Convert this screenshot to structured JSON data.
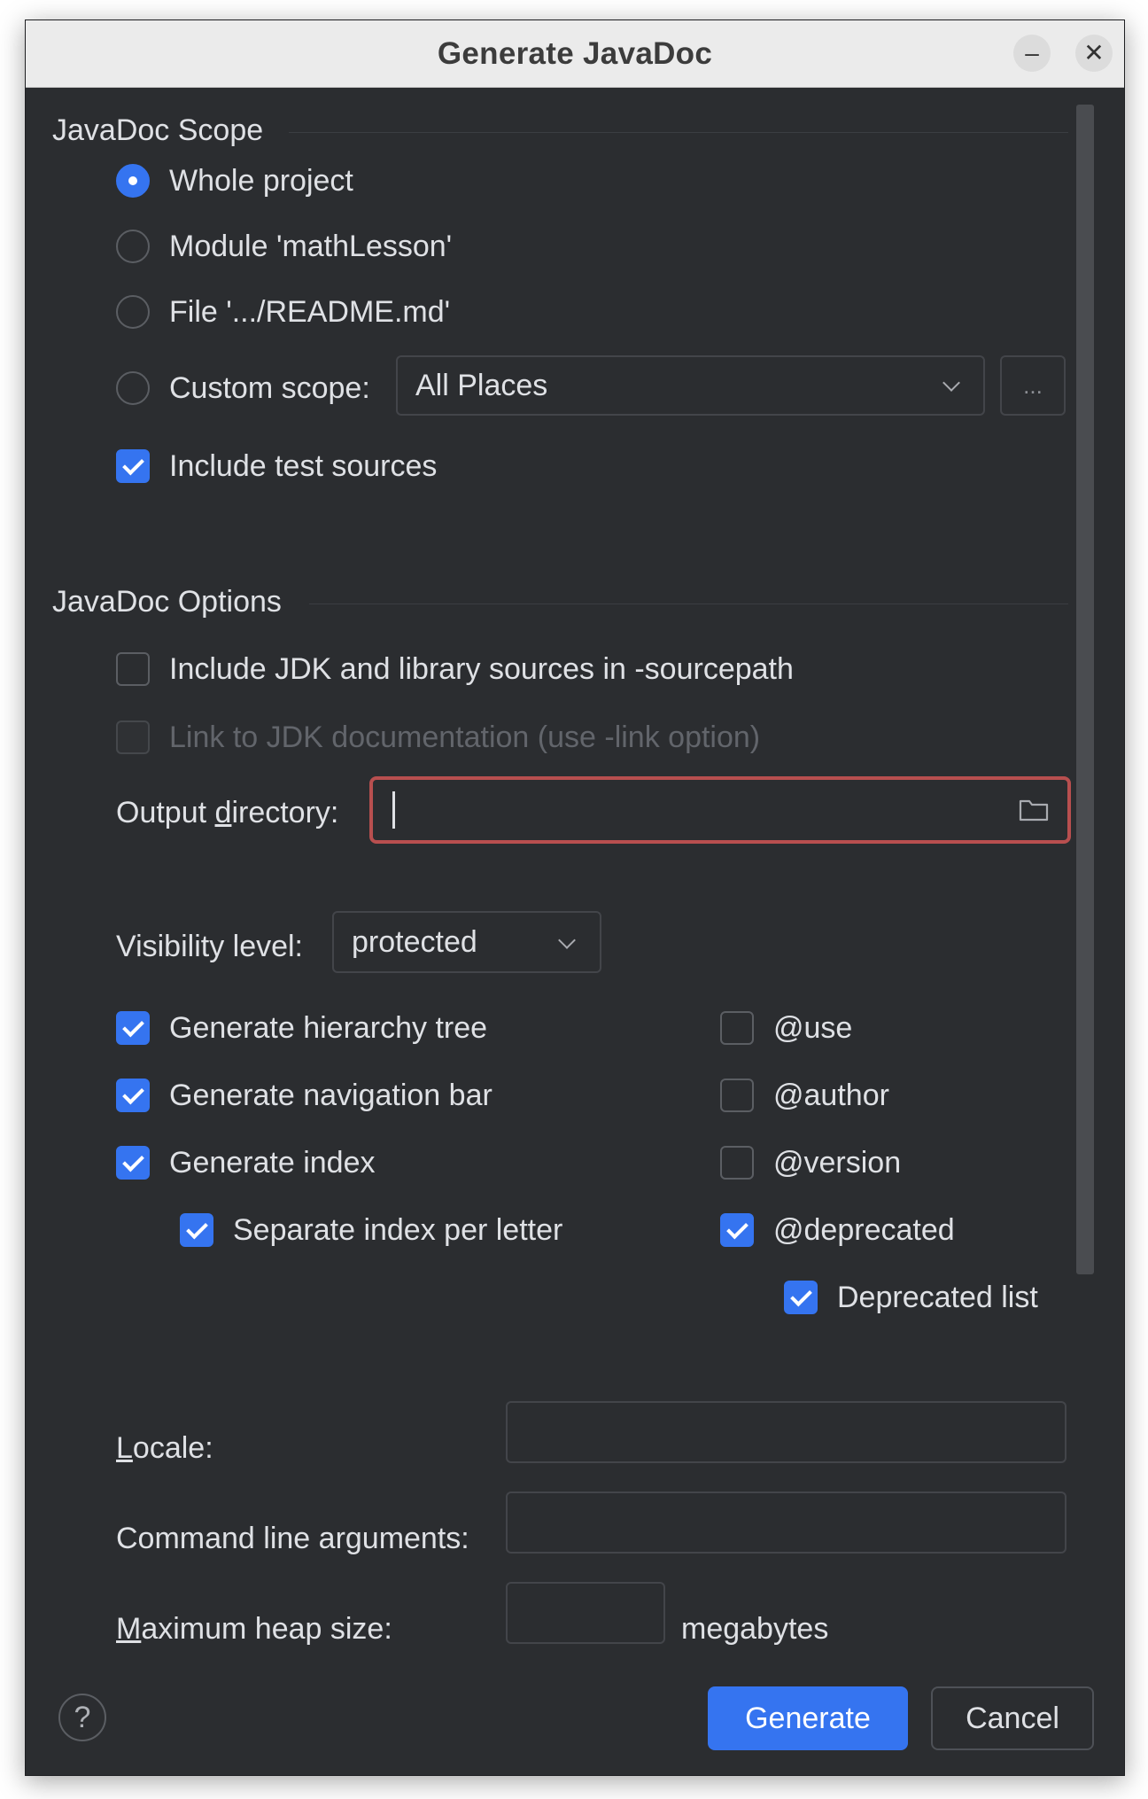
{
  "window": {
    "title": "Generate JavaDoc",
    "minimize_glyph": "–",
    "close_glyph": "✕"
  },
  "scope": {
    "section_title": "JavaDoc Scope",
    "options": [
      {
        "label": "Whole project",
        "selected": true
      },
      {
        "label": "Module 'mathLesson'",
        "selected": false
      },
      {
        "label": "File '.../README.md'",
        "selected": false
      },
      {
        "label": "Custom scope:",
        "selected": false
      }
    ],
    "custom_scope_value": "All Places",
    "browse_label": "...",
    "include_test_sources": {
      "label": "Include test sources",
      "checked": true
    }
  },
  "options": {
    "section_title": "JavaDoc Options",
    "include_jdk_sources": {
      "label": "Include JDK and library sources in -sourcepath",
      "checked": false
    },
    "link_jdk_docs": {
      "label": "Link to JDK documentation (use -link option)",
      "checked": false,
      "enabled": false
    },
    "output_directory": {
      "label_pre": "Output ",
      "label_mnemonic": "d",
      "label_post": "irectory:",
      "value": "",
      "error": true
    },
    "visibility": {
      "label": "Visibility level:",
      "value": "protected"
    },
    "left_checks": [
      {
        "label": "Generate hierarchy tree",
        "checked": true
      },
      {
        "label": "Generate navigation bar",
        "checked": true
      },
      {
        "label": "Generate index",
        "checked": true
      },
      {
        "label": "Separate index per letter",
        "checked": true
      }
    ],
    "right_checks": [
      {
        "label": "@use",
        "checked": false
      },
      {
        "label": "@author",
        "checked": false
      },
      {
        "label": "@version",
        "checked": false
      },
      {
        "label": "@deprecated",
        "checked": true
      },
      {
        "label": "Deprecated list",
        "checked": true
      }
    ],
    "locale": {
      "label_mnemonic": "L",
      "label_post": "ocale:",
      "value": ""
    },
    "command_line": {
      "label": "Command line arguments:",
      "value": ""
    },
    "max_heap": {
      "label_mnemonic": "M",
      "label_post": "aximum heap size:",
      "value": "",
      "unit": "megabytes"
    }
  },
  "footer": {
    "help_glyph": "?",
    "generate_label": "Generate",
    "cancel_label": "Cancel"
  },
  "colors": {
    "accent": "#3574f0",
    "background": "#2b2d30",
    "error_border": "#b84f4f"
  },
  "icons": [
    "minimize-icon",
    "close-icon",
    "chevron-down-icon",
    "folder-icon",
    "help-icon"
  ]
}
